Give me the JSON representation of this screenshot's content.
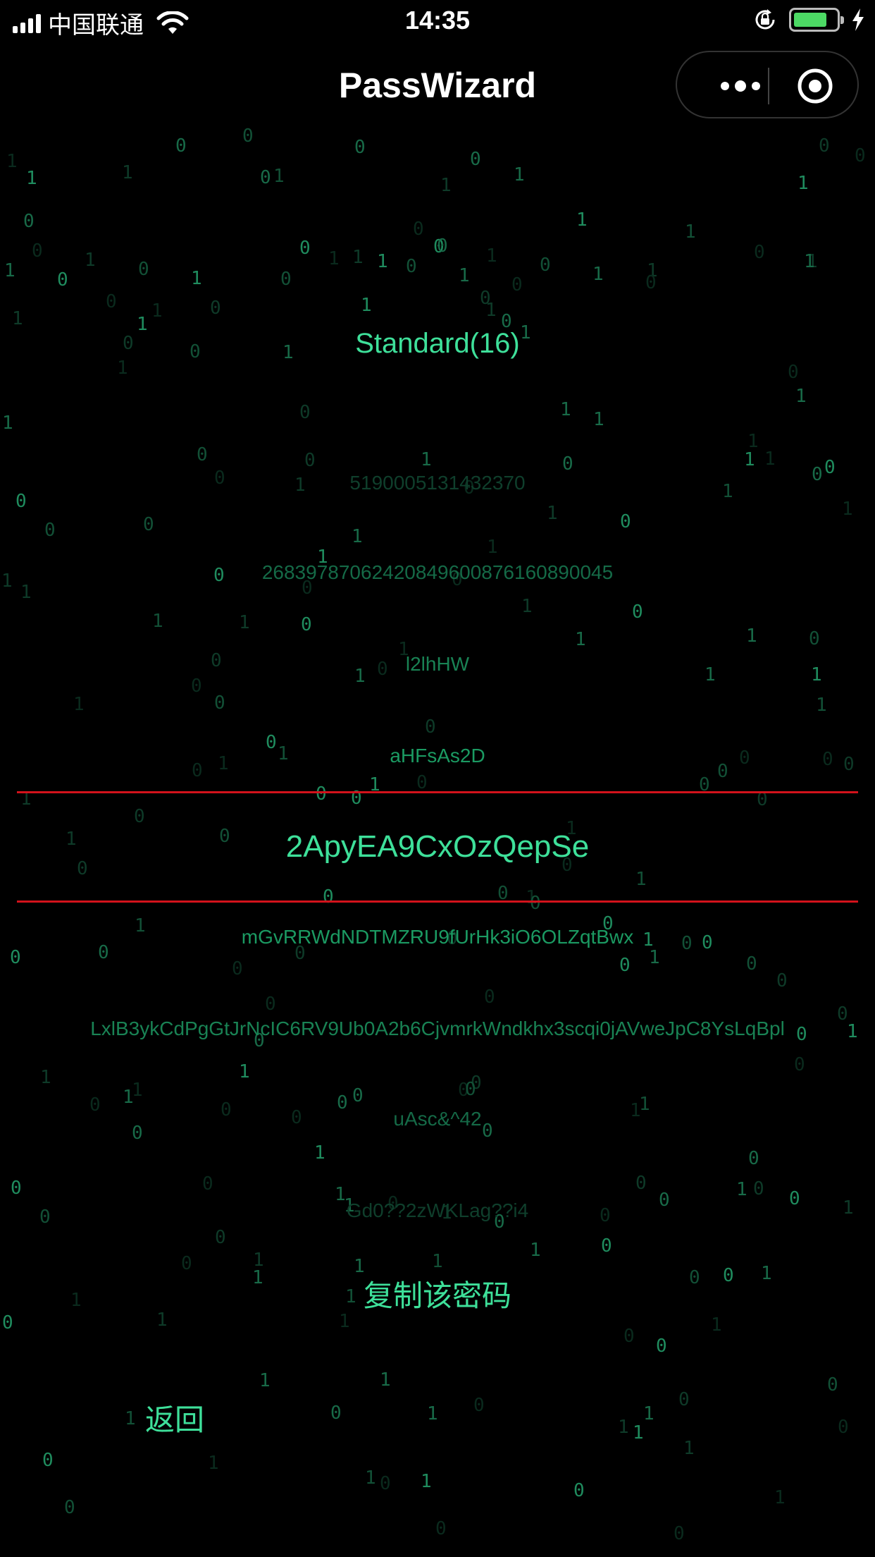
{
  "status_bar": {
    "carrier": "中国联通",
    "time": "14:35",
    "battery_level": 0.8
  },
  "nav": {
    "title": "PassWizard"
  },
  "generator": {
    "mode_label": "Standard(16)",
    "passwords_above": [
      "5190005131432370",
      "26839787062420849600876160890045",
      "l2lhHW",
      "aHFsAs2D"
    ],
    "selected_password": "2ApyEA9CxOzQepSe",
    "passwords_below": [
      "mGvRRWdNDTMZRU9fUrHk3iO6OLZqtBwx",
      "LxlB3ykCdPgGtJrNcIC6RV9Ub0A2b6CjvmrkWndkhx3scqi0jAVweJpC8YsLqBpl",
      "uAsc&^42",
      "Gd0??2zWKLag??i4"
    ],
    "copy_label": "复制该密码",
    "back_label": "返回"
  },
  "colors": {
    "accent": "#3ee09a",
    "selection_line": "#d2121b",
    "background": "#000000"
  }
}
